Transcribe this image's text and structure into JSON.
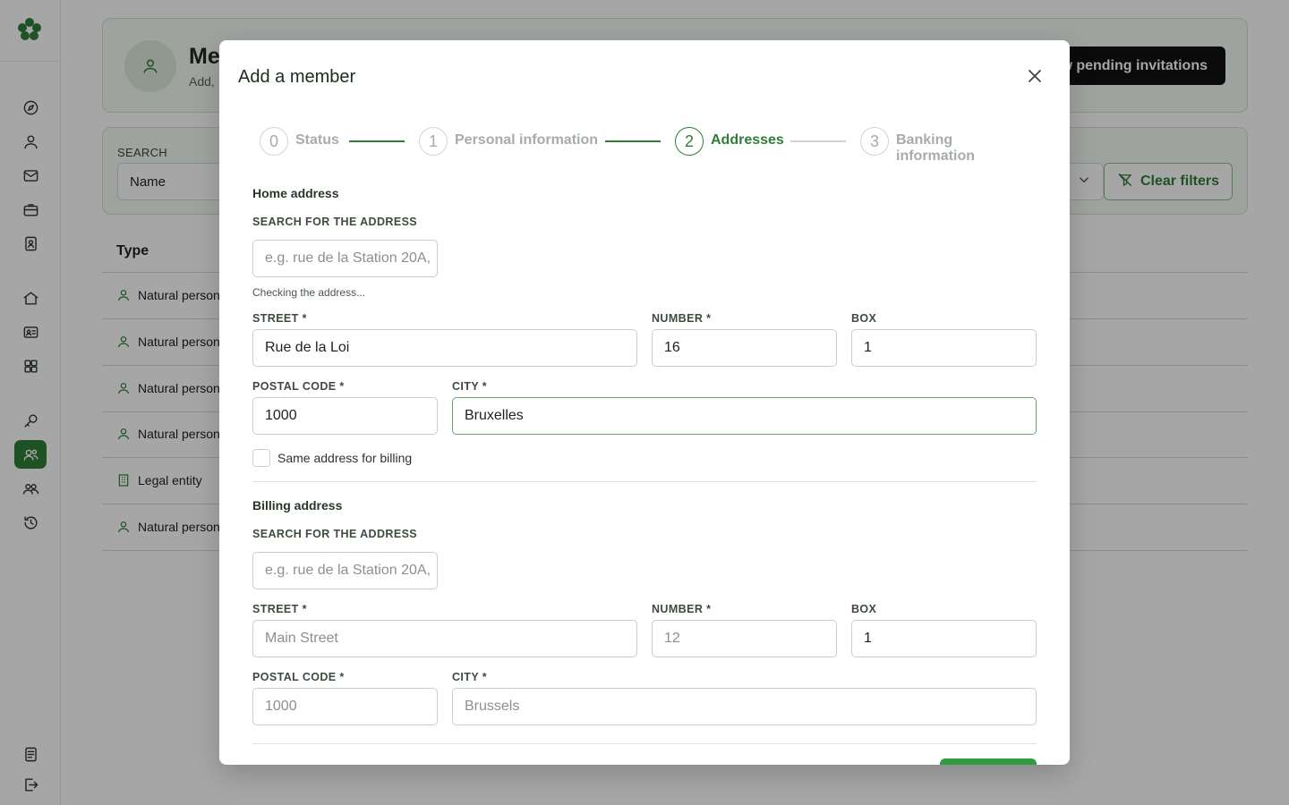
{
  "sidebar": {
    "items": [
      {
        "icon": "compass-icon"
      },
      {
        "icon": "user-icon"
      },
      {
        "icon": "mail-icon"
      },
      {
        "icon": "briefcase-icon"
      },
      {
        "icon": "contact-book-icon"
      },
      {
        "icon": "home-icon"
      },
      {
        "icon": "id-card-icon"
      },
      {
        "icon": "grid-icon"
      },
      {
        "icon": "key-icon"
      },
      {
        "icon": "members-icon",
        "active": true
      },
      {
        "icon": "group-icon"
      },
      {
        "icon": "history-icon"
      },
      {
        "icon": "document-icon"
      },
      {
        "icon": "logout-icon"
      }
    ]
  },
  "page": {
    "header": {
      "title": "Me",
      "subtitle": "Add, ",
      "pending_button": "ew pending invitations"
    },
    "filters": {
      "search_label": "SEARCH",
      "search_value": "Name",
      "clear_label": "Clear filters"
    },
    "table": {
      "type_header": "Type",
      "rows": [
        {
          "type": "Natural person",
          "icon": "user-icon"
        },
        {
          "type": "Natural person",
          "icon": "user-icon"
        },
        {
          "type": "Natural person",
          "icon": "user-icon"
        },
        {
          "type": "Natural person",
          "icon": "user-icon"
        },
        {
          "type": "Legal entity",
          "icon": "building-icon"
        },
        {
          "type": "Natural person",
          "icon": "user-icon"
        }
      ]
    }
  },
  "modal": {
    "title": "Add a member",
    "steps": [
      {
        "num": "0",
        "label": "Status",
        "state": "done"
      },
      {
        "num": "1",
        "label": "Personal information",
        "state": "done"
      },
      {
        "num": "2",
        "label": "Addresses",
        "state": "active"
      },
      {
        "num": "3",
        "label": "Banking information",
        "state": "todo"
      }
    ],
    "home": {
      "title": "Home address",
      "search_label": "SEARCH FOR THE ADDRESS",
      "search_placeholder": "e.g. rue de la Station 20A, ",
      "hint": "Checking the address...",
      "street_label": "STREET *",
      "street": "Rue de la Loi",
      "number_label": "NUMBER *",
      "number": "16",
      "box_label": "BOX",
      "box": "1",
      "postal_label": "POSTAL CODE *",
      "postal": "1000",
      "city_label": "CITY *",
      "city": "Bruxelles",
      "same_billing_label": "Same address for billing",
      "same_billing_checked": false
    },
    "billing": {
      "title": "Billing address",
      "search_label": "SEARCH FOR THE ADDRESS",
      "search_placeholder": "e.g. rue de la Station 20A, ",
      "street_label": "STREET *",
      "street_placeholder": "Main Street",
      "number_label": "NUMBER *",
      "number_placeholder": "12",
      "box_label": "BOX",
      "box": "1",
      "postal_label": "POSTAL CODE *",
      "postal_placeholder": "1000",
      "city_label": "CITY *",
      "city_placeholder": "Brussels"
    }
  },
  "colors": {
    "accent": "#2f7d37",
    "overlay": "rgba(0,0,0,0.35)"
  }
}
